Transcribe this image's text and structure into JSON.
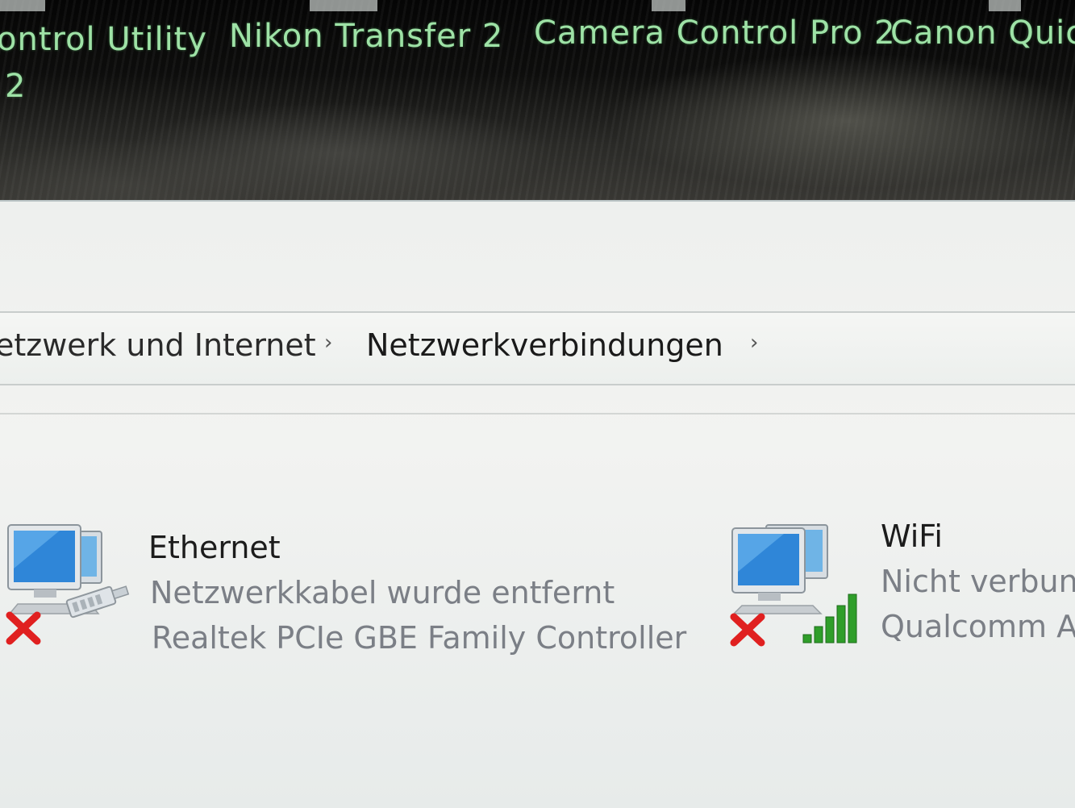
{
  "desktop": {
    "icons": [
      {
        "label": "ontrol Utility",
        "line2": "2"
      },
      {
        "label": "Nikon Transfer 2",
        "line2": ""
      },
      {
        "label": "Camera Control Pro 2",
        "line2": ""
      },
      {
        "label": "Canon Quick",
        "line2": ""
      }
    ]
  },
  "breadcrumb": {
    "items": [
      {
        "label": "etzwerk und Internet"
      },
      {
        "label": "Netzwerkverbindungen"
      }
    ],
    "separator": "›"
  },
  "connections": [
    {
      "name": "Ethernet",
      "status": "Netzwerkkabel wurde entfernt",
      "device": "Realtek PCIe GBE Family Controller",
      "icon": "ethernet-disconnected-icon"
    },
    {
      "name": "WiFi",
      "status": "Nicht verbun",
      "device": "Qualcomm A",
      "icon": "wifi-disconnected-icon"
    }
  ],
  "colors": {
    "desktop_label": "#9ee2a6",
    "error_x": "#e02020",
    "signal_green": "#2f9e2a"
  }
}
